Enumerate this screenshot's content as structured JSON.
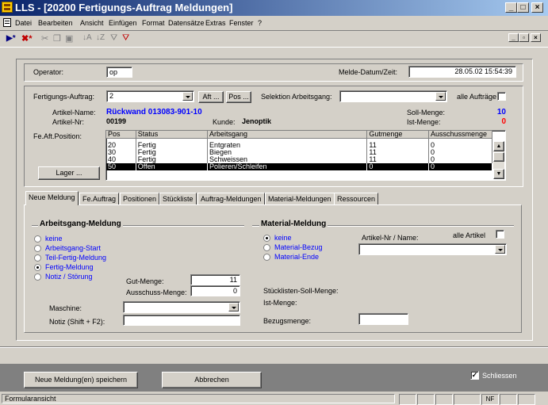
{
  "window": {
    "title": "LLS - [20200 Fertigungs-Auftrag Meldungen]"
  },
  "menu": [
    "Datei",
    "Bearbeiten",
    "Ansicht",
    "Einfügen",
    "Format",
    "Datensätze",
    "Extras",
    "Fenster",
    "?"
  ],
  "header": {
    "operator_label": "Operator:",
    "operator_value": "op",
    "melde_label": "Melde-Datum/Zeit:",
    "melde_value": "28.05.02 15:54:39"
  },
  "auftrag": {
    "label": "Fertigungs-Auftrag:",
    "value": "2",
    "aft_button": "Aft ...",
    "pos_button": "Pos ...",
    "selektion_label": "Selektion Arbeitsgang:",
    "selektion_value": "",
    "alle_auftraege_label": "alle Aufträge",
    "artikel_name_label": "Artikel-Name:",
    "artikel_name_value": "Rückwand 013083-901-10",
    "artikel_nr_label": "Artikel-Nr:",
    "artikel_nr_value": "00199",
    "kunde_label": "Kunde:",
    "kunde_value": "Jenoptik",
    "soll_label": "Soll-Menge:",
    "soll_value": "10",
    "ist_label": "Ist-Menge:",
    "ist_value": "0",
    "position_label": "Fe.Aft.Position:",
    "lager_button": "Lager ..."
  },
  "table": {
    "columns": [
      "Pos",
      "Status",
      "Arbeitsgang",
      "Gutmenge",
      "Ausschussmenge"
    ],
    "rows": [
      [
        "20",
        "Fertig",
        "Entgraten",
        "11",
        "0"
      ],
      [
        "30",
        "Fertig",
        "Biegen",
        "11",
        "0"
      ],
      [
        "40",
        "Fertig",
        "Schweissen",
        "11",
        "0"
      ],
      [
        "50",
        "Offen",
        "Polieren/Schleifen",
        "0",
        "0"
      ]
    ]
  },
  "tabs": [
    "Neue Meldung",
    "Fe.Auftrag",
    "Positionen",
    "Stückliste",
    "Auftrag-Meldungen",
    "Material-Meldungen",
    "Ressourcen"
  ],
  "arbeitsgang": {
    "title": "Arbeitsgang-Meldung",
    "options": [
      "keine",
      "Arbeitsgang-Start",
      "Teil-Fertig-Meldung",
      "Fertig-Meldung",
      "Notiz / Störung"
    ],
    "gut_label": "Gut-Menge:",
    "gut_value": "11",
    "ausschuss_label": "Ausschuss-Menge:",
    "ausschuss_value": "0",
    "maschine_label": "Maschine:",
    "maschine_value": "",
    "notiz_label": "Notiz (Shift + F2):",
    "notiz_value": ""
  },
  "material": {
    "title": "Material-Meldung",
    "options": [
      "keine",
      "Material-Bezug",
      "Material-Ende"
    ],
    "artikel_label": "Artikel-Nr / Name:",
    "alle_artikel_label": "alle Artikel",
    "artikel_value": "",
    "stueckliste_label": "Stücklisten-Soll-Menge:",
    "ist_label": "Ist-Menge:",
    "bezug_label": "Bezugsmenge:",
    "bezug_value": ""
  },
  "footer": {
    "save_button": "Neue Meldung(en) speichern",
    "cancel_button": "Abbrechen",
    "schliessen_label": "Schliessen",
    "status_text": "Formularansicht",
    "nf": "NF"
  },
  "colors": {
    "title_start": "#0a246a",
    "title_end": "#a6caf0",
    "link_blue": "#0000ff",
    "soll_blue": "#0000ff",
    "ist_red": "#ff0000"
  }
}
